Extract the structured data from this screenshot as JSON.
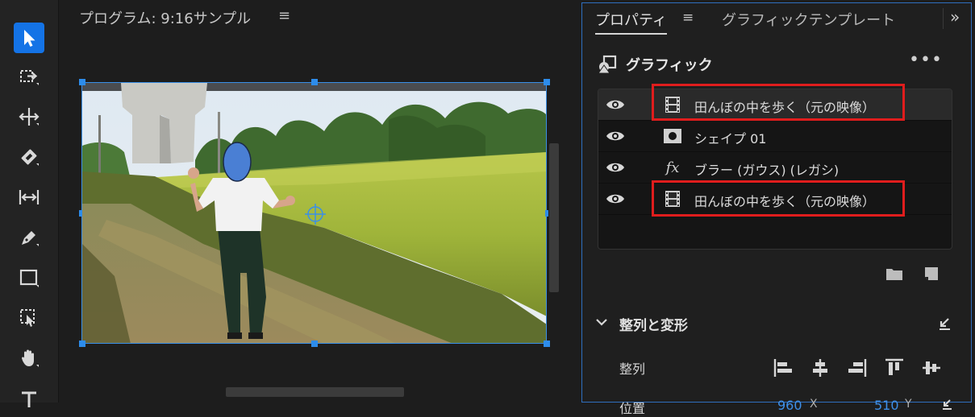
{
  "program": {
    "title": "プログラム: 9:16サンプル",
    "menu": "≡"
  },
  "properties_panel": {
    "tabs": [
      {
        "label": "プロパティ",
        "active": true
      },
      {
        "label": "グラフィックテンプレート",
        "active": false
      }
    ],
    "tab_menu": "≡",
    "overflow": "»",
    "graphic": {
      "title": "グラフィック",
      "more": "•••"
    },
    "layers": [
      {
        "name": "田んぼの中を歩く（元の映像）",
        "kind": "video-clip-icon",
        "selected": true,
        "highlighted": true
      },
      {
        "name": "シェイプ 01",
        "kind": "shape-icon",
        "selected": false,
        "highlighted": false
      },
      {
        "name": "ブラー (ガウス) (レガシ)",
        "kind": "fx",
        "kind_text": "fx",
        "selected": false,
        "highlighted": false
      },
      {
        "name": "田んぼの中を歩く（元の映像）",
        "kind": "video-clip-icon",
        "selected": false,
        "highlighted": true
      }
    ],
    "align_transform": {
      "title": "整列と変形",
      "align_label": "整列",
      "position_label": "位置",
      "position_x": "960",
      "position_x_unit": "X",
      "position_y": "510",
      "position_y_unit": "Y"
    }
  },
  "colors": {
    "accent": "#1473e6",
    "highlight_box": "#e01d1d",
    "value_blue": "#3e8fe8"
  },
  "icons": {
    "toolbar": [
      "selection-tool-icon",
      "track-select-forward-icon",
      "ripple-edit-icon",
      "razor-icon",
      "slip-icon",
      "pen-icon",
      "rectangle-icon",
      "auto-reframe-icon",
      "hand-icon",
      "type-icon"
    ]
  }
}
